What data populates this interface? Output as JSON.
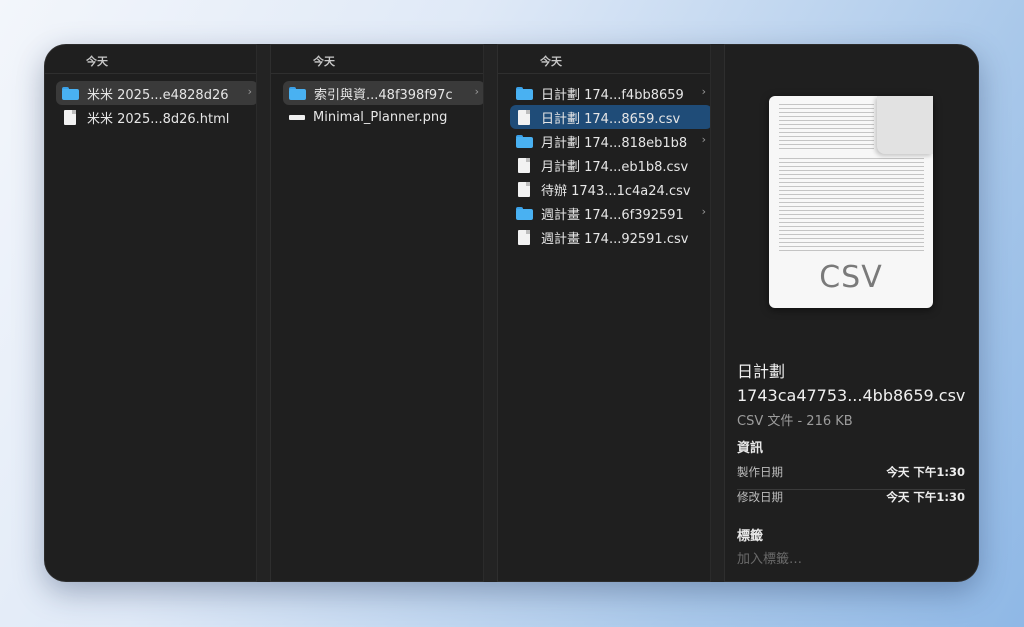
{
  "columns": [
    {
      "header": "今天",
      "items": [
        {
          "label": "米米 2025...e4828d26",
          "type": "folder",
          "chevron": "›",
          "selected": "gray"
        },
        {
          "label": "米米 2025...8d26.html",
          "type": "file"
        }
      ]
    },
    {
      "header": "今天",
      "items": [
        {
          "label": "索引與資...48f398f97c",
          "type": "folder",
          "chevron": "›",
          "selected": "gray"
        },
        {
          "label": "Minimal_Planner.png",
          "type": "image"
        }
      ]
    },
    {
      "header": "今天",
      "items": [
        {
          "label": "日計劃 174...f4bb8659",
          "type": "folder",
          "chevron": "›"
        },
        {
          "label": "日計劃 174...8659.csv",
          "type": "file",
          "selected": "blue"
        },
        {
          "label": "月計劃 174...818eb1b8",
          "type": "folder",
          "chevron": "›"
        },
        {
          "label": "月計劃 174...eb1b8.csv",
          "type": "file"
        },
        {
          "label": "待辦 1743...1c4a24.csv",
          "type": "file"
        },
        {
          "label": "週計畫 174...6f392591",
          "type": "folder",
          "chevron": "›"
        },
        {
          "label": "週計畫 174...92591.csv",
          "type": "file"
        }
      ]
    }
  ],
  "preview": {
    "icon_ext": "CSV",
    "name_line1": "日計劃",
    "name_line2": "1743ca47753...4bb8659.csv",
    "kind": "CSV 文件 - 216 KB",
    "info_title": "資訊",
    "created_label": "製作日期",
    "created_value": "今天 下午1:30",
    "modified_label": "修改日期",
    "modified_value": "今天 下午1:30",
    "tags_title": "標籤",
    "add_tags": "加入標籤…"
  },
  "colors": {
    "window_bg": "#1f1f1f",
    "selection_blue": "#1f4c78",
    "selection_gray": "#3a3a3a",
    "folder": "#49b1f2"
  }
}
